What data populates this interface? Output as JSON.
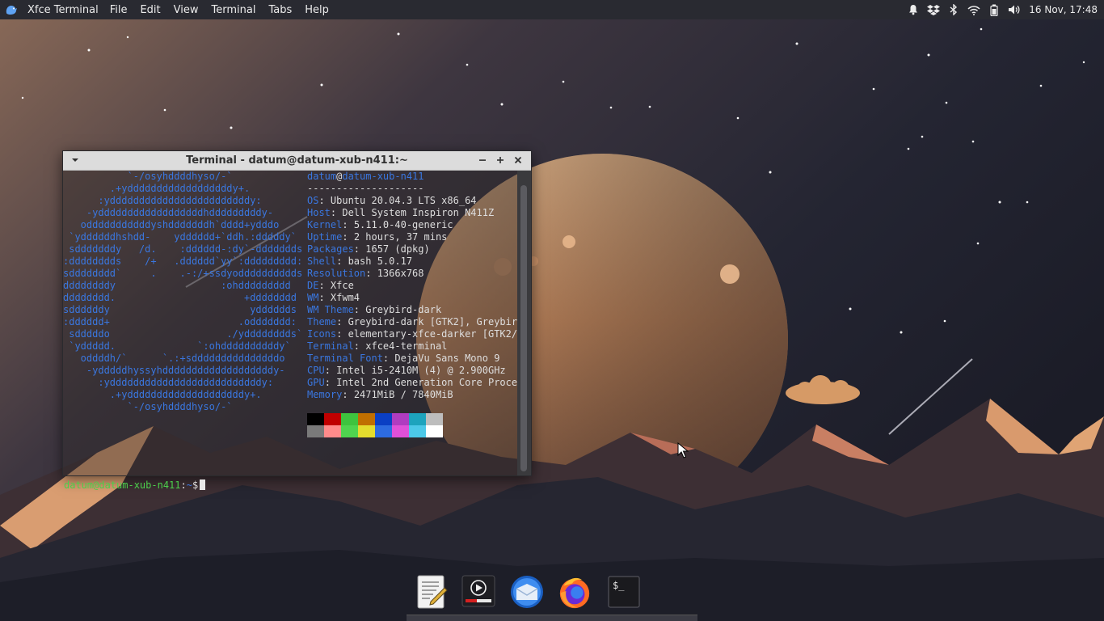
{
  "top_panel": {
    "app_name": "Xfce Terminal",
    "menu": [
      "File",
      "Edit",
      "View",
      "Terminal",
      "Tabs",
      "Help"
    ],
    "tray_icons": [
      "notification-bell-icon",
      "dropbox-icon",
      "bluetooth-icon",
      "wifi-icon",
      "battery-icon",
      "volume-icon"
    ],
    "clock": "16 Nov, 17:48"
  },
  "terminal": {
    "title": "Terminal - datum@datum-xub-n411:~",
    "ascii_art": [
      "           `-/osyhddddhyso/-`",
      "        .+yddddddddddddddddddy+.",
      "      :yddddddddddddddddddddddddy:",
      "    -yddddddddddddddddddhdddddddddy-",
      "   odddddddddddyshdddddddh`dddd+ydddo",
      " `yddddddhshdd-    ydddddd+`ddh.:dddddy`",
      " sdddddddy   /d.    :dddddd-:dy`-ddddddds",
      ":dddddddds    /+   .dddddd`yy`:ddddddddd:",
      "sdddddddd`     .    .-:/+ssdyodddddddddds",
      "ddddddddy                  :ohddddddddd",
      "dddddddd.                      +dddddddd",
      "sddddddy                        ydddddds",
      ":dddddd+                      .oddddddd:",
      " sdddddo                    ./ydddddddds`",
      " `yddddd.              `:ohddddddddddy`",
      "   oddddh/`      `.:+sdddddddddddddddo",
      "    -ydddddhyssyhdddddddddddddddddddy-",
      "      :yddddddddddddddddddddddddddy:",
      "        .+yddddddddddddddddddddy+.",
      "           `-/osyhddddhyso/-`"
    ],
    "user": "datum",
    "at": "@",
    "host": "datum-xub-n411",
    "separator": "--------------------",
    "info": [
      {
        "key": "OS",
        "value": "Ubuntu 20.04.3 LTS x86_64"
      },
      {
        "key": "Host",
        "value": "Dell System Inspiron N411Z"
      },
      {
        "key": "Kernel",
        "value": "5.11.0-40-generic"
      },
      {
        "key": "Uptime",
        "value": "2 hours, 37 mins"
      },
      {
        "key": "Packages",
        "value": "1657 (dpkg)"
      },
      {
        "key": "Shell",
        "value": "bash 5.0.17"
      },
      {
        "key": "Resolution",
        "value": "1366x768"
      },
      {
        "key": "DE",
        "value": "Xfce"
      },
      {
        "key": "WM",
        "value": "Xfwm4"
      },
      {
        "key": "WM Theme",
        "value": "Greybird-dark"
      },
      {
        "key": "Theme",
        "value": "Greybird-dark [GTK2], Greybir"
      },
      {
        "key": "Icons",
        "value": "elementary-xfce-darker [GTK2/"
      },
      {
        "key": "Terminal",
        "value": "xfce4-terminal"
      },
      {
        "key": "Terminal Font",
        "value": "DejaVu Sans Mono 9"
      },
      {
        "key": "CPU",
        "value": "Intel i5-2410M (4) @ 2.900GHz"
      },
      {
        "key": "GPU",
        "value": "Intel 2nd Generation Core Proce"
      },
      {
        "key": "Memory",
        "value": "2471MiB / 7840MiB"
      }
    ],
    "palette_dark": [
      "#000000",
      "#c00000",
      "#3ec43e",
      "#c06f00",
      "#0a3fc4",
      "#b03cc0",
      "#1da3bd",
      "#bdbdbd"
    ],
    "palette_bright": [
      "#7a7a7a",
      "#ff8b8b",
      "#4fd44f",
      "#e4dc2e",
      "#2d6be0",
      "#e050d8",
      "#4cc8e8",
      "#ffffff"
    ],
    "prompt": {
      "user_host": "datum@datum-xub-n411",
      "sep": ":",
      "dir": "~",
      "symbol": "$"
    }
  },
  "dock": {
    "items": [
      "text-editor-icon",
      "media-player-icon",
      "mail-client-icon",
      "firefox-icon",
      "terminal-icon"
    ],
    "terminal_icon_text": "$_"
  }
}
